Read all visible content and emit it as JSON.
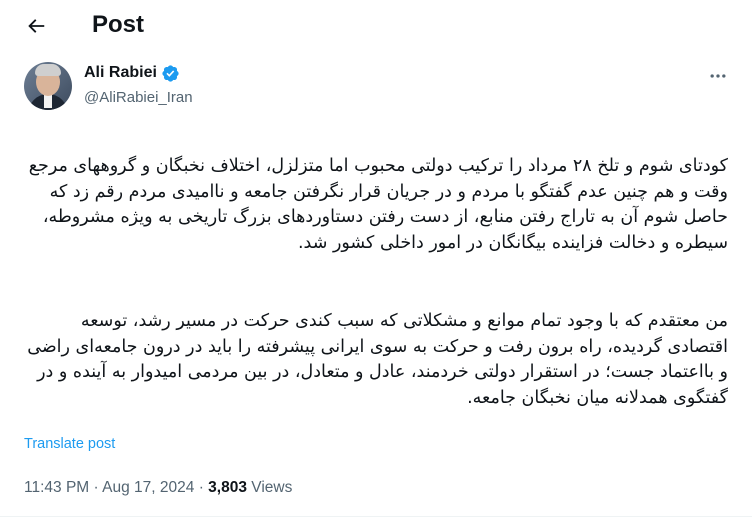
{
  "header": {
    "title": "Post",
    "back_icon": "arrow-left-icon"
  },
  "author": {
    "display_name": "Ali Rabiei",
    "handle": "@AliRabiei_Iran",
    "verified": true,
    "verified_color": "#1d9bf0"
  },
  "post": {
    "paragraph_1": "کودتای شوم و تلخ ۲۸ مرداد را ترکیب دولتی محبوب اما متزلزل، اختلاف نخبگان و گروههای مرجع وقت و هم چنین عدم گفتگو با مردم و در جریان قرار نگرفتن جامعه و ناامیدی مردم رقم زد که حاصل شوم آن به تاراج رفتن منابع، از دست رفتن دستاوردهای بزرگ تاریخی به ویژه مشروطه، سیطره و دخالت فزاینده بیگانگان در امور داخلی کشور شد.",
    "paragraph_2": "من معتقدم که با وجود تمام موانع و مشکلاتی که سبب کندی حرکت در مسیر رشد، توسعه اقتصادی گردیده، راه برون رفت و حرکت به سوی ایرانی پیشرفته را باید در درون جامعه‌ای راضی و بااعتماد جست؛ در استقرار دولتی خردمند، عادل و متعادل، در بین مردمی امیدوار به آینده و در گفتگوی همدلانه میان نخبگان جامعه.",
    "translate_label": "Translate post",
    "time": "11:43 PM",
    "separator": "·",
    "date": "Aug 17, 2024",
    "views_count": "3,803",
    "views_label": "Views"
  },
  "colors": {
    "accent": "#1d9bf0",
    "text": "#0f1419",
    "muted": "#536471"
  }
}
